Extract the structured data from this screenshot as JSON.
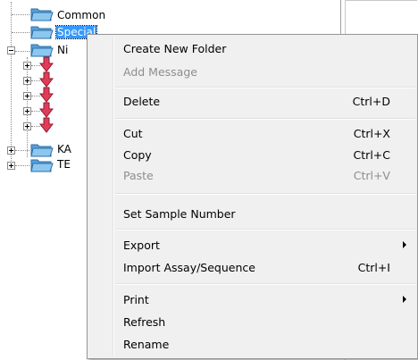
{
  "tree": {
    "nodes": [
      {
        "label": "Common",
        "selected": false
      },
      {
        "label": "Special",
        "selected": true
      },
      {
        "label": "Ni",
        "selected": false
      },
      {
        "label": "KA",
        "selected": false
      },
      {
        "label": "TE",
        "selected": false
      }
    ]
  },
  "context_menu": {
    "items": [
      {
        "label": "Create New Folder",
        "shortcut": "",
        "enabled": true,
        "submenu": false
      },
      {
        "label": "Add Message",
        "shortcut": "",
        "enabled": false,
        "submenu": false
      },
      {
        "label": "Delete",
        "shortcut": "Ctrl+D",
        "enabled": true,
        "submenu": false
      },
      {
        "label": "Cut",
        "shortcut": "Ctrl+X",
        "enabled": true,
        "submenu": false
      },
      {
        "label": "Copy",
        "shortcut": "Ctrl+C",
        "enabled": true,
        "submenu": false
      },
      {
        "label": "Paste",
        "shortcut": "Ctrl+V",
        "enabled": false,
        "submenu": false
      },
      {
        "label": "Set Sample Number",
        "shortcut": "",
        "enabled": true,
        "submenu": false
      },
      {
        "label": "Export",
        "shortcut": "",
        "enabled": true,
        "submenu": true
      },
      {
        "label": "Import Assay/Sequence",
        "shortcut": "Ctrl+I",
        "enabled": true,
        "submenu": false
      },
      {
        "label": "Print",
        "shortcut": "",
        "enabled": true,
        "submenu": true
      },
      {
        "label": "Refresh",
        "shortcut": "",
        "enabled": true,
        "submenu": false
      },
      {
        "label": "Rename",
        "shortcut": "",
        "enabled": true,
        "submenu": false
      }
    ]
  },
  "colors": {
    "selection": "#3399ff",
    "folder": "#6fb2e6",
    "assay_arrow": "#e03c5a",
    "menu_background": "#f0f0f0"
  },
  "icons": {
    "folder": "folder-icon",
    "assay": "red-down-arrow-icon",
    "submenu": "submenu-arrow-icon"
  }
}
